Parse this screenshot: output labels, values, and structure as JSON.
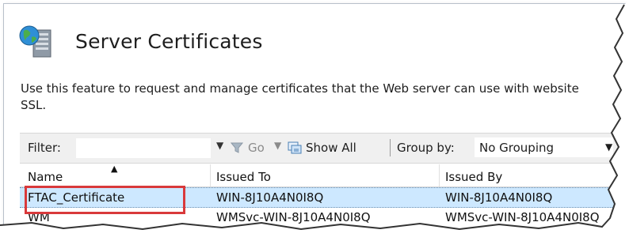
{
  "page": {
    "title": "Server Certificates",
    "description_line1": "Use this feature to request and manage certificates that the Web server can use with website",
    "description_line2": "SSL."
  },
  "toolbar": {
    "filter_label": "Filter:",
    "filter_value": "",
    "go_label": "Go",
    "show_all_label": "Show All",
    "group_by_label": "Group by:",
    "group_by_value": "No Grouping"
  },
  "table": {
    "columns": [
      "Name",
      "Issued To",
      "Issued By"
    ],
    "rows": [
      {
        "name": "FTAC_Certificate",
        "issued_to": "WIN-8J10A4N0I8Q",
        "issued_by": "WIN-8J10A4N0I8Q"
      },
      {
        "name": "WM",
        "issued_to": "WMSvc-WIN-8J10A4N0I8Q",
        "issued_by": "WMSvc-WIN-8J10A4N0I8Q"
      }
    ]
  },
  "colors": {
    "selection": "#cde8ff",
    "highlight_box": "#d9393b",
    "toolbar_bg": "#f0f0f0"
  },
  "icons": {
    "header": "server-globe-icon",
    "go": "funnel-icon",
    "show_all": "show-all-icon"
  }
}
